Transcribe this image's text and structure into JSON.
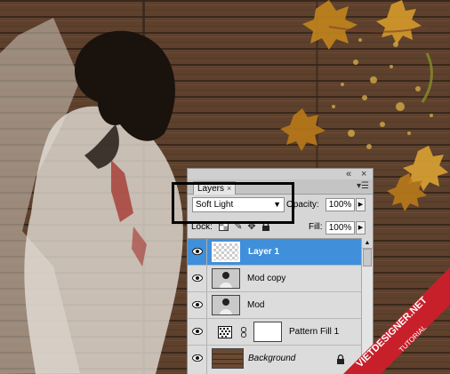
{
  "layers_panel": {
    "tab_label": "Layers",
    "tab_close": "×",
    "collapse_btn": "«",
    "close_btn": "×",
    "menu_btn": "▾☰",
    "blend_mode": "Soft Light",
    "opacity_label": "Opacity:",
    "opacity_value": "100%",
    "lock_label": "Lock:",
    "fill_label": "Fill:",
    "fill_value": "100%",
    "layers": [
      {
        "name": "Layer 1",
        "selected": true
      },
      {
        "name": "Mod copy",
        "selected": false
      },
      {
        "name": "Mod",
        "selected": false
      },
      {
        "name": "Pattern Fill 1",
        "selected": false
      },
      {
        "name": "Background",
        "selected": false,
        "locked": true
      }
    ]
  },
  "watermark": {
    "site": "VIETDESIGNER.NET",
    "tag": "TUTORIAL",
    "color": "#c8202a"
  },
  "colors": {
    "selection": "#3f8fdb",
    "wood": "#6b4a33"
  }
}
